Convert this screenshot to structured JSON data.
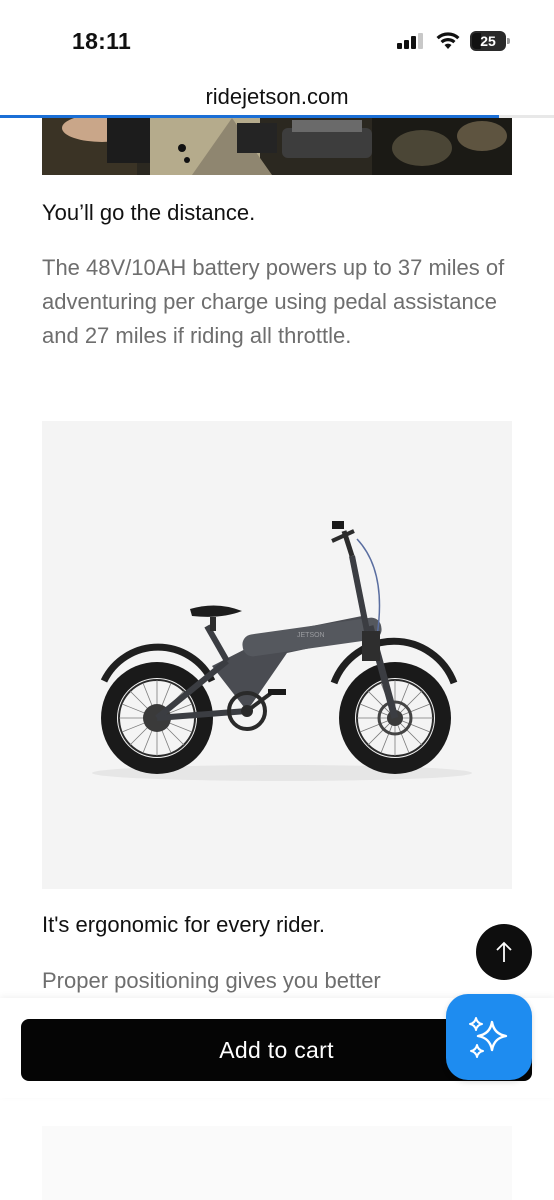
{
  "status_bar": {
    "time": "18:11",
    "battery_level": "25",
    "icons": [
      "signal-icon",
      "wifi-icon",
      "battery-icon"
    ]
  },
  "browser": {
    "url": "ridejetson.com",
    "load_progress": 0.9,
    "accent_color": "#1b6fd6"
  },
  "sections": [
    {
      "title": "You’ll go the distance.",
      "body": "The 48V/10AH battery powers up to 37 miles of adventuring per charge using pedal assistance and 27 miles if riding all throttle."
    },
    {
      "title": "It's ergonomic for every rider.",
      "body": "Proper positioning gives you better"
    }
  ],
  "product_image": {
    "frame_brand_text": "JETSON"
  },
  "actions": {
    "add_to_cart_label": "Add to cart",
    "scroll_top_icon": "arrow-up-icon",
    "assistant_icon": "sparkles-icon",
    "assistant_color": "#1e8cf0"
  }
}
